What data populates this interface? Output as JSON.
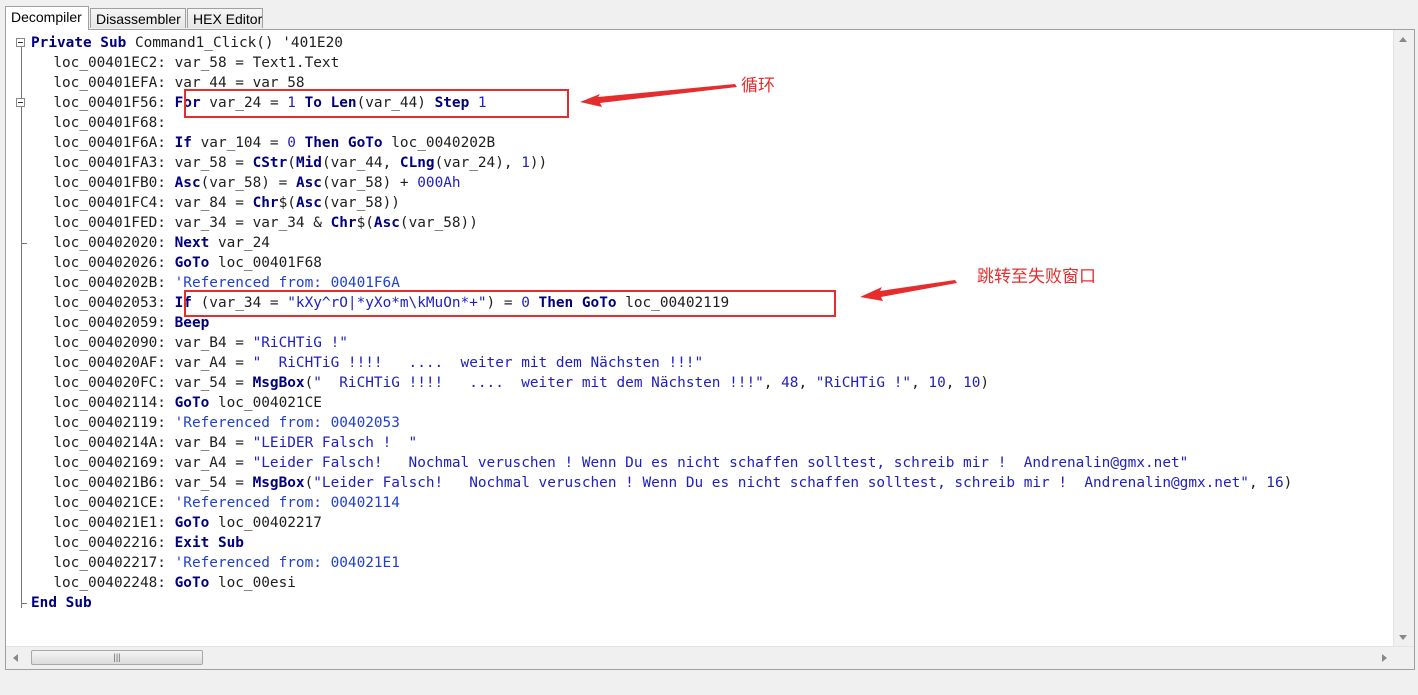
{
  "tabs": [
    {
      "label": "Decompiler",
      "active": true
    },
    {
      "label": "Disassembler",
      "active": false
    },
    {
      "label": "HEX Editor",
      "active": false
    }
  ],
  "code_lines": [
    [
      [
        "kw",
        "Private Sub"
      ],
      [
        "op",
        " Command1_Click() "
      ],
      [
        "op",
        "'401E20"
      ]
    ],
    [
      [
        "op",
        "  loc_00401EC2: var_58 = Text1.Text"
      ]
    ],
    [
      [
        "op",
        "  loc_00401EFA: var_44 = var_58"
      ]
    ],
    [
      [
        "op",
        "  loc_00401F56: "
      ],
      [
        "kw",
        "For"
      ],
      [
        "op",
        " var_24 "
      ],
      [
        "op",
        "= "
      ],
      [
        "num",
        "1"
      ],
      [
        "op",
        " "
      ],
      [
        "kw",
        "To Len"
      ],
      [
        "op",
        "(var_44) "
      ],
      [
        "kw",
        "Step"
      ],
      [
        "op",
        " "
      ],
      [
        "num",
        "1"
      ]
    ],
    [
      [
        "op",
        "  loc_00401F68:"
      ]
    ],
    [
      [
        "op",
        "  loc_00401F6A: "
      ],
      [
        "kw",
        "If"
      ],
      [
        "op",
        " var_104 = "
      ],
      [
        "num",
        "0"
      ],
      [
        "op",
        " "
      ],
      [
        "kw",
        "Then GoTo"
      ],
      [
        "op",
        " loc_0040202B"
      ]
    ],
    [
      [
        "op",
        "  loc_00401FA3: var_58 = "
      ],
      [
        "kw",
        "CStr"
      ],
      [
        "op",
        "("
      ],
      [
        "kw",
        "Mid"
      ],
      [
        "op",
        "(var_44, "
      ],
      [
        "kw",
        "CLng"
      ],
      [
        "op",
        "(var_24), "
      ],
      [
        "num",
        "1"
      ],
      [
        "op",
        "))"
      ]
    ],
    [
      [
        "op",
        "  loc_00401FB0: "
      ],
      [
        "kw",
        "Asc"
      ],
      [
        "op",
        "(var_58) = "
      ],
      [
        "kw",
        "Asc"
      ],
      [
        "op",
        "(var_58) + "
      ],
      [
        "num",
        "000Ah"
      ]
    ],
    [
      [
        "op",
        "  loc_00401FC4: var_84 = "
      ],
      [
        "kw",
        "Chr"
      ],
      [
        "op",
        "$("
      ],
      [
        "kw",
        "Asc"
      ],
      [
        "op",
        "(var_58))"
      ]
    ],
    [
      [
        "op",
        "  loc_00401FED: var_34 = var_34 & "
      ],
      [
        "kw",
        "Chr"
      ],
      [
        "op",
        "$("
      ],
      [
        "kw",
        "Asc"
      ],
      [
        "op",
        "(var_58))"
      ]
    ],
    [
      [
        "op",
        "  loc_00402020: "
      ],
      [
        "kw",
        "Next"
      ],
      [
        "op",
        " var_24"
      ]
    ],
    [
      [
        "op",
        "  loc_00402026: "
      ],
      [
        "kw",
        "GoTo"
      ],
      [
        "op",
        " loc_00401F68"
      ]
    ],
    [
      [
        "op",
        "  loc_0040202B: "
      ],
      [
        "cm",
        "'Referenced from: 00401F6A"
      ]
    ],
    [
      [
        "op",
        "  loc_00402053: "
      ],
      [
        "kw",
        "If"
      ],
      [
        "op",
        " (var_34 = "
      ],
      [
        "str",
        "\"kXy^rO|*yXo*m\\kMuOn*+\""
      ],
      [
        "op",
        ") = "
      ],
      [
        "num",
        "0"
      ],
      [
        "op",
        " "
      ],
      [
        "kw",
        "Then GoTo"
      ],
      [
        "op",
        " loc_00402119"
      ]
    ],
    [
      [
        "op",
        "  loc_00402059: "
      ],
      [
        "kw",
        "Beep"
      ]
    ],
    [
      [
        "op",
        "  loc_00402090: var_B4 = "
      ],
      [
        "str",
        "\"RiCHTiG !\""
      ]
    ],
    [
      [
        "op",
        "  loc_004020AF: var_A4 = "
      ],
      [
        "str",
        "\"  RiCHTiG !!!!   ....  weiter mit dem Nächsten !!!\""
      ]
    ],
    [
      [
        "op",
        "  loc_004020FC: var_54 = "
      ],
      [
        "kw",
        "MsgBox"
      ],
      [
        "op",
        "("
      ],
      [
        "str",
        "\"  RiCHTiG !!!!   ....  weiter mit dem Nächsten !!!\""
      ],
      [
        "op",
        ", "
      ],
      [
        "num",
        "48"
      ],
      [
        "op",
        ", "
      ],
      [
        "str",
        "\"RiCHTiG !\""
      ],
      [
        "op",
        ", "
      ],
      [
        "num",
        "10"
      ],
      [
        "op",
        ", "
      ],
      [
        "num",
        "10"
      ],
      [
        "op",
        ")"
      ]
    ],
    [
      [
        "op",
        "  loc_00402114: "
      ],
      [
        "kw",
        "GoTo"
      ],
      [
        "op",
        " loc_004021CE"
      ]
    ],
    [
      [
        "op",
        "  loc_00402119: "
      ],
      [
        "cm",
        "'Referenced from: 00402053"
      ]
    ],
    [
      [
        "op",
        "  loc_0040214A: var_B4 = "
      ],
      [
        "str",
        "\"LEiDER Falsch !  \""
      ]
    ],
    [
      [
        "op",
        "  loc_00402169: var_A4 = "
      ],
      [
        "str",
        "\"Leider Falsch!   Nochmal veruschen ! Wenn Du es nicht schaffen solltest, schreib mir !  Andrenalin@gmx.net\""
      ]
    ],
    [
      [
        "op",
        "  loc_004021B6: var_54 = "
      ],
      [
        "kw",
        "MsgBox"
      ],
      [
        "op",
        "("
      ],
      [
        "str",
        "\"Leider Falsch!   Nochmal veruschen ! Wenn Du es nicht schaffen solltest, schreib mir !  Andrenalin@gmx.net\""
      ],
      [
        "op",
        ", "
      ],
      [
        "num",
        "16"
      ],
      [
        "op",
        ")"
      ]
    ],
    [
      [
        "op",
        "  loc_004021CE: "
      ],
      [
        "cm",
        "'Referenced from: 00402114"
      ]
    ],
    [
      [
        "op",
        "  loc_004021E1: "
      ],
      [
        "kw",
        "GoTo"
      ],
      [
        "op",
        " loc_00402217"
      ]
    ],
    [
      [
        "op",
        "  loc_00402216: "
      ],
      [
        "kw",
        "Exit Sub"
      ]
    ],
    [
      [
        "op",
        "  loc_00402217: "
      ],
      [
        "cm",
        "'Referenced from: 004021E1"
      ]
    ],
    [
      [
        "op",
        "  loc_00402248: "
      ],
      [
        "kw",
        "GoTo"
      ],
      [
        "op",
        " loc_00esi"
      ]
    ],
    [
      [
        "kw",
        "End Sub"
      ]
    ]
  ],
  "annotations": {
    "loop_label": "循环",
    "jump_label": "跳转至失败窗口"
  },
  "colors": {
    "keyword": "#00007f",
    "string": "#2020c0",
    "annotation": "#e52d2d"
  }
}
